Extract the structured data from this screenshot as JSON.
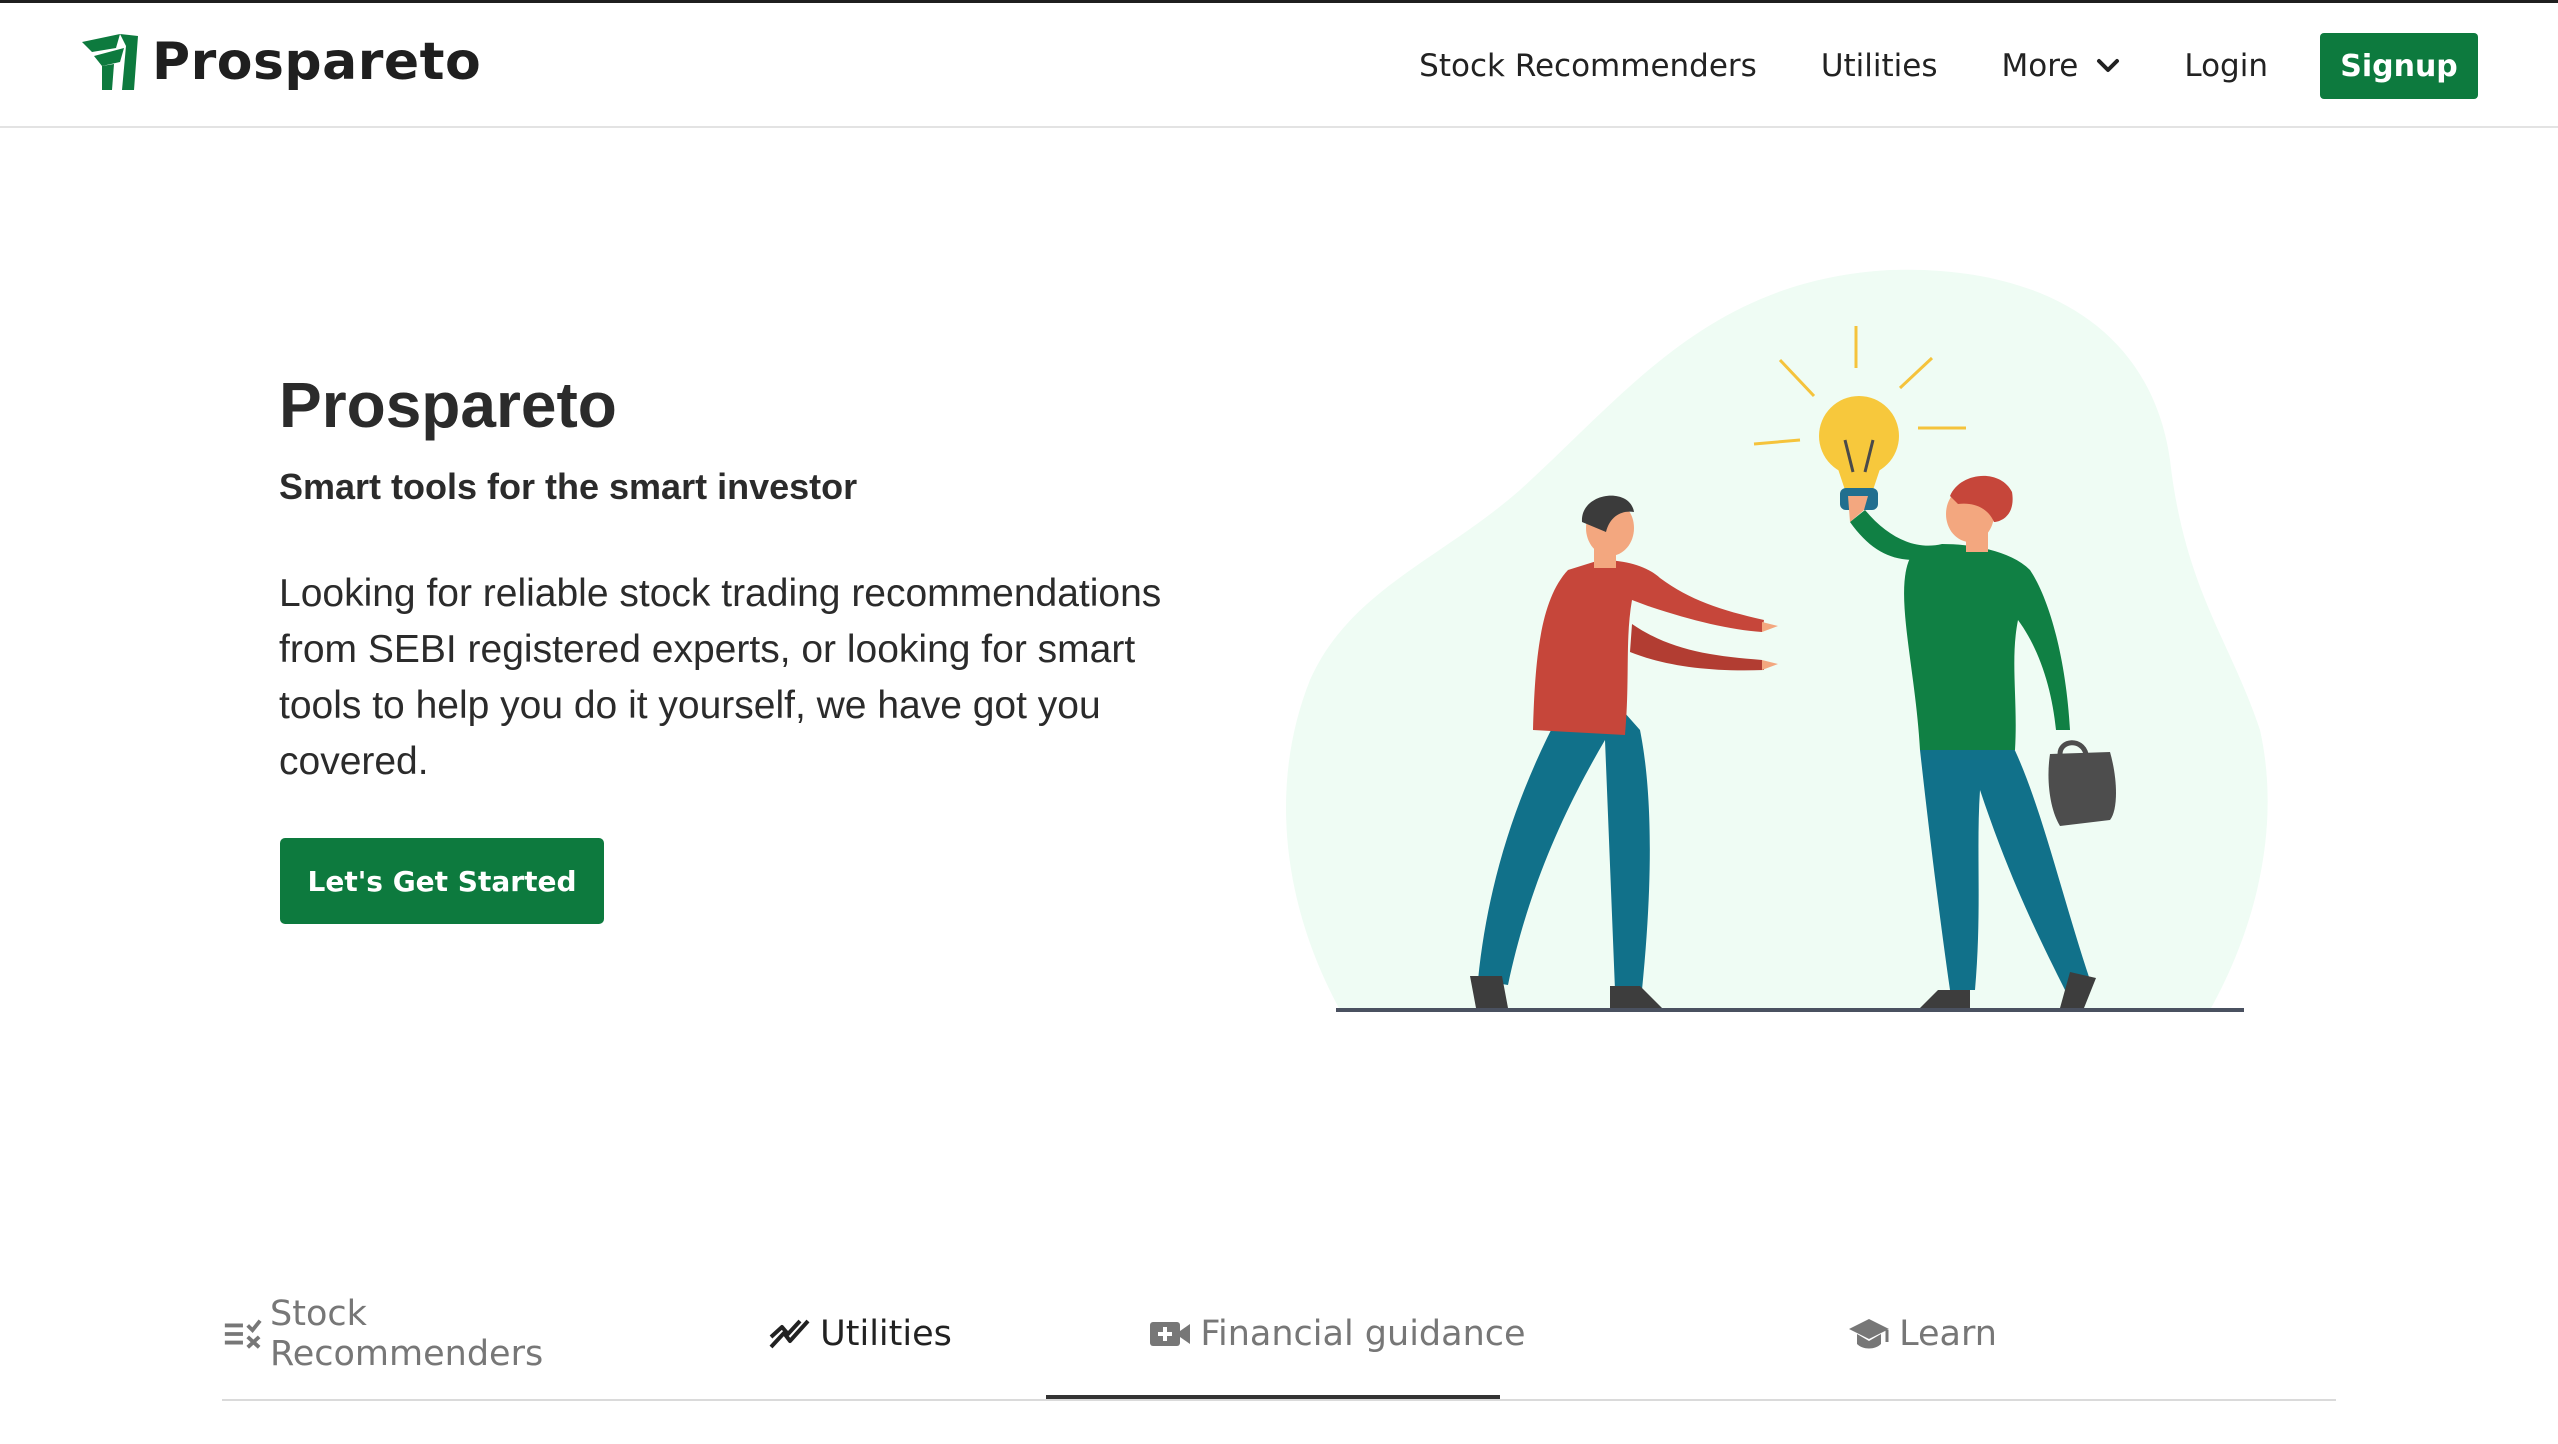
{
  "brand": {
    "name": "Prospareto",
    "accent": "#0d7a3e"
  },
  "nav": {
    "items": [
      {
        "label": "Stock Recommenders"
      },
      {
        "label": "Utilities"
      },
      {
        "label": "More",
        "icon": "chevron-down-icon"
      },
      {
        "label": "Login"
      }
    ],
    "signup_label": "Signup"
  },
  "hero": {
    "title": "Prospareto",
    "tagline": "Smart tools for the smart investor",
    "description": "Looking for reliable stock trading recommendations from SEBI registered experts, or looking for smart tools to help you do it yourself, we have got you covered.",
    "cta_label": "Let's Get Started"
  },
  "tabs": [
    {
      "label": "Stock Recommenders",
      "icon": "list-x-icon",
      "active": false
    },
    {
      "label": "Utilities",
      "icon": "trend-icon",
      "active": true
    },
    {
      "label": "Financial guidance",
      "icon": "video-plus-icon",
      "active": false
    },
    {
      "label": "Learn",
      "icon": "graduation-cap-icon",
      "active": false
    }
  ]
}
